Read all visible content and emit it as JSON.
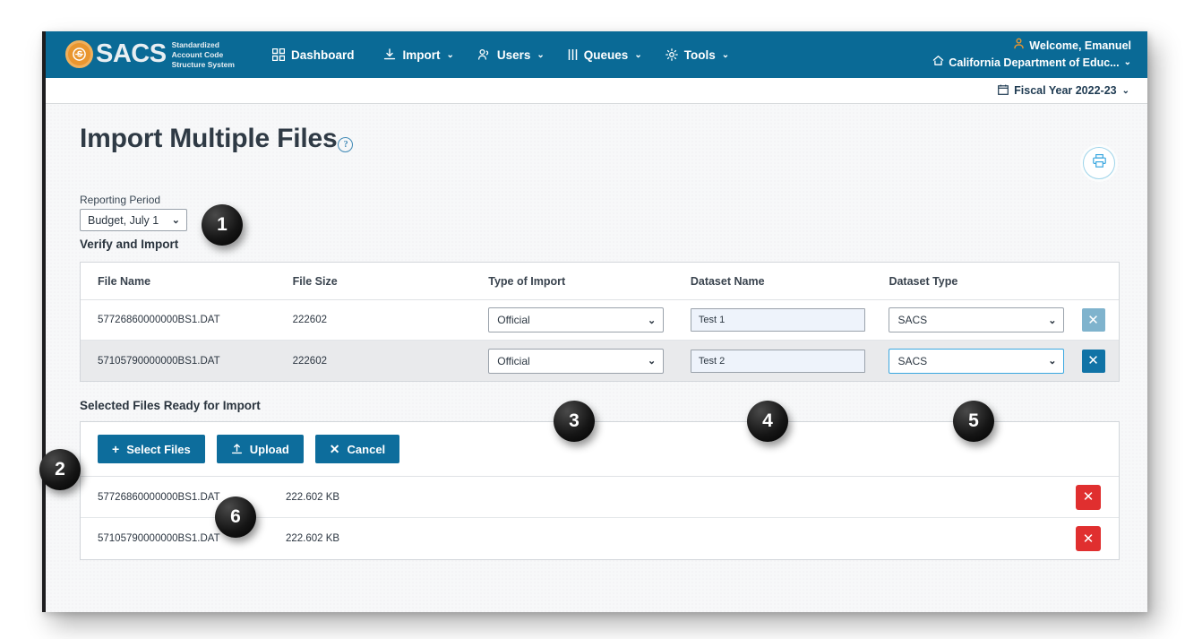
{
  "header": {
    "brand_name": "SACS",
    "brand_sub_line1": "Standardized",
    "brand_sub_line2": "Account Code",
    "brand_sub_line3": "Structure System",
    "logo_icon": "sacs-circle-logo",
    "nav": [
      {
        "label": "Dashboard",
        "icon": "grid-icon",
        "caret": ""
      },
      {
        "label": "Import",
        "icon": "download-icon",
        "caret": "⌄"
      },
      {
        "label": "Users",
        "icon": "users-icon",
        "caret": "⌄"
      },
      {
        "label": "Queues",
        "icon": "queue-bars-icon",
        "caret": "⌄"
      },
      {
        "label": "Tools",
        "icon": "gear-icon",
        "caret": "⌄"
      }
    ],
    "welcome": "Welcome, Emanuel",
    "welcome_icon": "person-icon",
    "organization": "California Department of Educ...",
    "organization_icon": "home-icon",
    "organization_caret": "⌄",
    "fiscal_year": "Fiscal Year 2022-23",
    "fiscal_year_icon": "calendar-icon",
    "fiscal_year_caret": "⌄"
  },
  "page": {
    "title": "Import Multiple Files",
    "help_icon": "question-mark-icon",
    "print_icon": "printer-icon"
  },
  "reporting_period": {
    "label": "Reporting Period",
    "value": "Budget, July 1",
    "caret": "⌄"
  },
  "verify": {
    "heading": "Verify and Import",
    "columns": [
      "File Name",
      "File Size",
      "Type of Import",
      "Dataset Name",
      "Dataset Type"
    ],
    "remove_icon": "✕",
    "caret": "⌄",
    "rows": [
      {
        "file_name": "57726860000000BS1.DAT",
        "file_size": "222602",
        "type_of_import": "Official",
        "dataset_name": "Test 1",
        "dataset_type": "SACS"
      },
      {
        "file_name": "57105790000000BS1.DAT",
        "file_size": "222602",
        "type_of_import": "Official",
        "dataset_name": "Test 2",
        "dataset_type": "SACS"
      }
    ]
  },
  "selected_files": {
    "heading": "Selected Files Ready for Import",
    "buttons": [
      {
        "label": "Select Files",
        "glyph": "+",
        "icon": "plus-icon"
      },
      {
        "label": "Upload",
        "glyph": "",
        "icon": "upload-icon"
      },
      {
        "label": "Cancel",
        "glyph": "✕",
        "icon": "close-icon"
      }
    ],
    "delete_icon": "✕",
    "rows": [
      {
        "file_name": "57726860000000BS1.DAT",
        "file_size": "222.602 KB"
      },
      {
        "file_name": "57105790000000BS1.DAT",
        "file_size": "222.602 KB"
      }
    ]
  },
  "callouts": [
    {
      "number": "1"
    },
    {
      "number": "2"
    },
    {
      "number": "3"
    },
    {
      "number": "4"
    },
    {
      "number": "5"
    },
    {
      "number": "6"
    }
  ],
  "colors": {
    "brand_blue": "#0a6a96",
    "button_blue": "#0d6d9c",
    "logo_orange": "#e9962f",
    "delete_red": "#e02f2f",
    "accent_light_blue": "#9ed4ea"
  }
}
